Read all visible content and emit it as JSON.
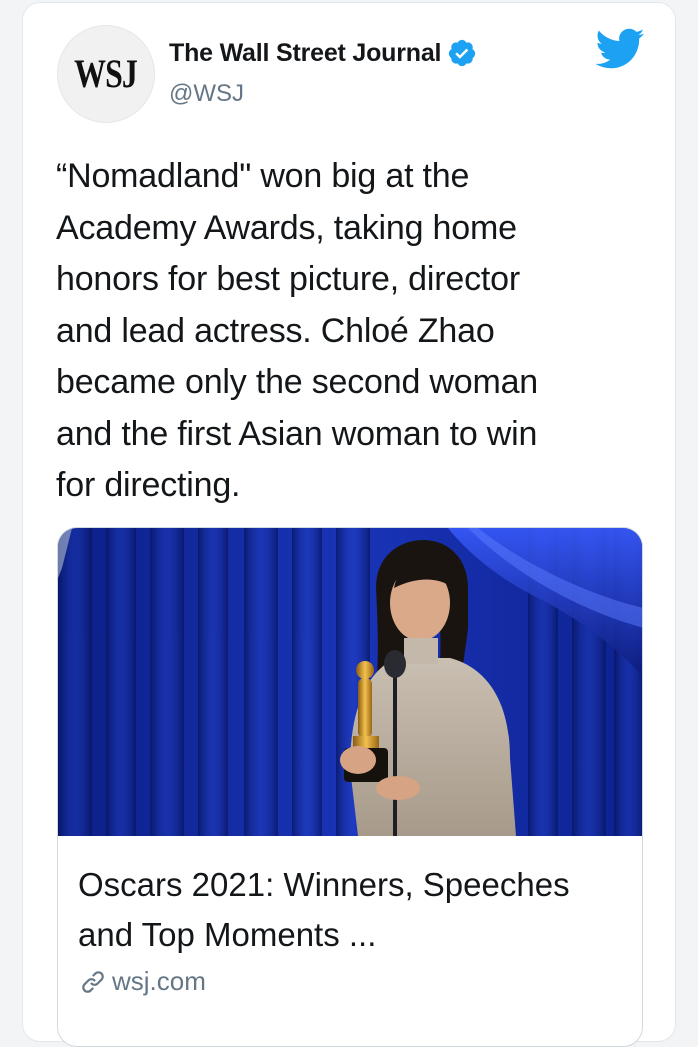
{
  "account": {
    "avatar_text": "WSJ",
    "display_name": "The Wall Street Journal",
    "handle": "@WSJ",
    "verified": true
  },
  "icons": {
    "verified": "verified-badge-icon",
    "brand": "twitter-bird-icon",
    "link": "link-icon"
  },
  "colors": {
    "brand_blue": "#1da1f2",
    "text": "#14171a",
    "secondary_text": "#657786"
  },
  "tweet": {
    "text": "“Nomadland\" won big at the\nAcademy Awards, taking home\nhonors for best picture, director\nand lead actress. Chloé Zhao\nbecame only the second woman\nand the first Asian woman to win\nfor directing."
  },
  "card": {
    "title": "Oscars 2021: Winners, Speeches and Top Moments ...",
    "domain": "wsj.com"
  }
}
